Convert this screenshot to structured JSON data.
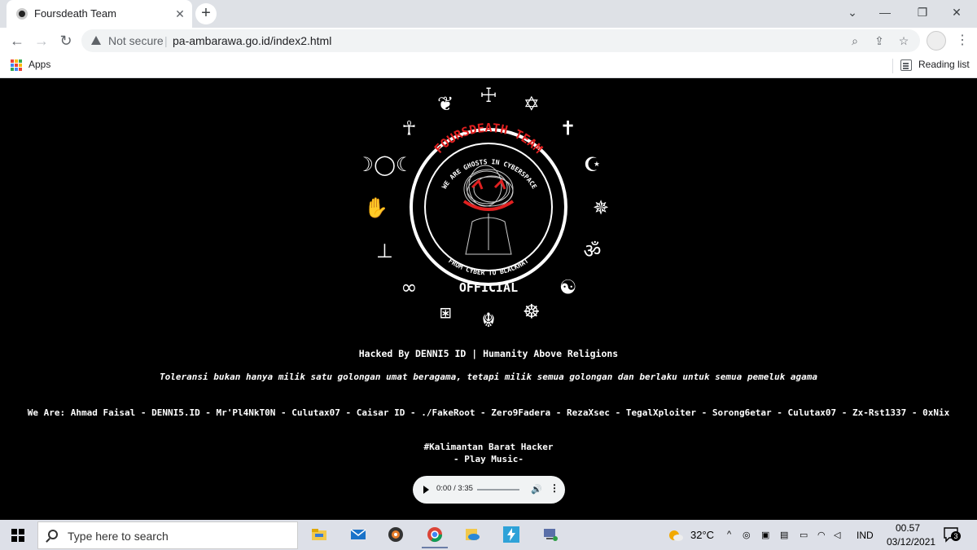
{
  "browser": {
    "tab_title": "Foursdeath Team",
    "tab_close": "✕",
    "new_tab": "+",
    "window_controls": {
      "minimize": "—",
      "chevron": "⌄",
      "restore": "❐",
      "close": "✕"
    },
    "security_label": "Not secure",
    "separator": "|",
    "url": "pa-ambarawa.go.id/index2.html",
    "nav": {
      "back": "←",
      "forward": "→",
      "reload": "↻"
    },
    "omni_icons": {
      "zoom": "⌕",
      "share": "⇪",
      "star": "☆"
    },
    "menu": "⋮"
  },
  "bookmarks": {
    "apps_label": "Apps",
    "apps_colors": [
      "#ea4335",
      "#fbbc04",
      "#34a853",
      "#4285f4",
      "#ea4335",
      "#fbbc04",
      "#34a853",
      "#4285f4",
      "#ea4335"
    ],
    "reading_list_label": "Reading list"
  },
  "logo": {
    "team_name": "FOURSDEATH TEAM",
    "motto": "WE ARE GHOSTS IN CYBERSPACE",
    "tagline": "FROM CYBER TO BLACKHAT",
    "official": "OFFICIAL",
    "accent_color": "#e02020",
    "symbols": [
      "☩",
      "✡",
      "✝",
      "☪",
      "✵",
      "ॐ",
      "☯",
      "☸",
      "☬",
      "⧆",
      "∞",
      "⊥",
      "✋",
      "☽◯☾",
      "☥",
      "❦"
    ]
  },
  "page": {
    "hacked_line": "Hacked By DENNI5 ID | Humanity Above Religions",
    "toleransi_line": "Toleransi bukan hanya milik satu golongan umat beragama, tetapi milik semua golongan dan berlaku untuk semua pemeluk agama",
    "we_are_line": "We Are: Ahmad Faisal - DENNI5.ID - Mr'Pl4NkT0N - Culutax07 - Caisar ID - ./FakeRoot - Zero9Fadera - RezaXsec - TegalXploiter - Sorong6etar - Culutax07 - Zx-Rst1337 - 0xNix",
    "region_line": "#Kalimantan Barat Hacker",
    "music_line": "- Play Music-",
    "audio_time": "0:00 / 3:35",
    "audio_volume_icon": "🔊",
    "audio_more_icon": "⋮"
  },
  "taskbar": {
    "search_placeholder": "Type here to search",
    "weather": "32°C",
    "language": "IND",
    "time": "00.57",
    "date": "03/12/2021",
    "notification_count": "3",
    "tray_chevron": "^"
  }
}
